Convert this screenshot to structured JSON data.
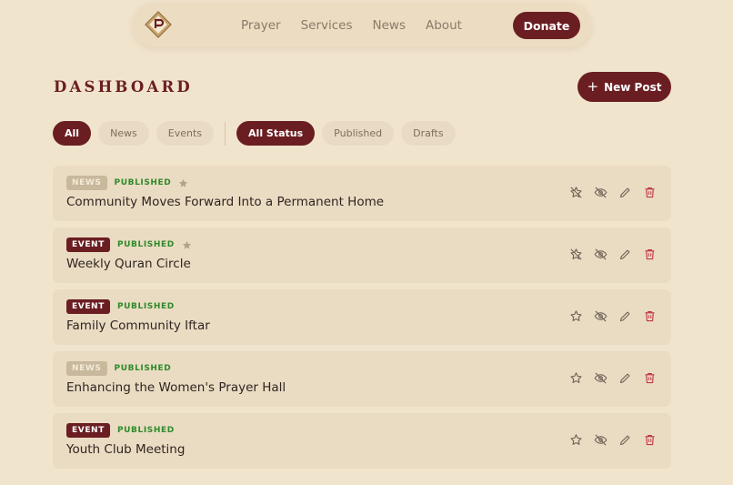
{
  "nav": {
    "links": [
      "Prayer",
      "Services",
      "News",
      "About"
    ],
    "donate_label": "Donate"
  },
  "header": {
    "title": "DASHBOARD",
    "new_post_label": "New Post"
  },
  "filters": {
    "type": [
      "All",
      "News",
      "Events"
    ],
    "status": [
      "All Status",
      "Published",
      "Drafts"
    ],
    "active_type": "All",
    "active_status": "All Status"
  },
  "posts": [
    {
      "type": "NEWS",
      "status": "PUBLISHED",
      "title": "Community Moves Forward Into a Permanent Home",
      "featured": true
    },
    {
      "type": "EVENT",
      "status": "PUBLISHED",
      "title": "Weekly Quran Circle",
      "featured": true
    },
    {
      "type": "EVENT",
      "status": "PUBLISHED",
      "title": "Family Community Iftar",
      "featured": false
    },
    {
      "type": "NEWS",
      "status": "PUBLISHED",
      "title": "Enhancing the Women's Prayer Hall",
      "featured": false
    },
    {
      "type": "EVENT",
      "status": "PUBLISHED",
      "title": "Youth Club Meeting",
      "featured": false
    }
  ],
  "colors": {
    "background": "#f1e4cd",
    "brand": "#6b1e22",
    "published": "#2e8a2a",
    "delete": "#c0354a"
  },
  "icons": {
    "featured_action": "star-off-icon",
    "unfeatured_action": "star-icon",
    "hide": "eye-off-icon",
    "edit": "pencil-icon",
    "delete": "trash-icon"
  }
}
